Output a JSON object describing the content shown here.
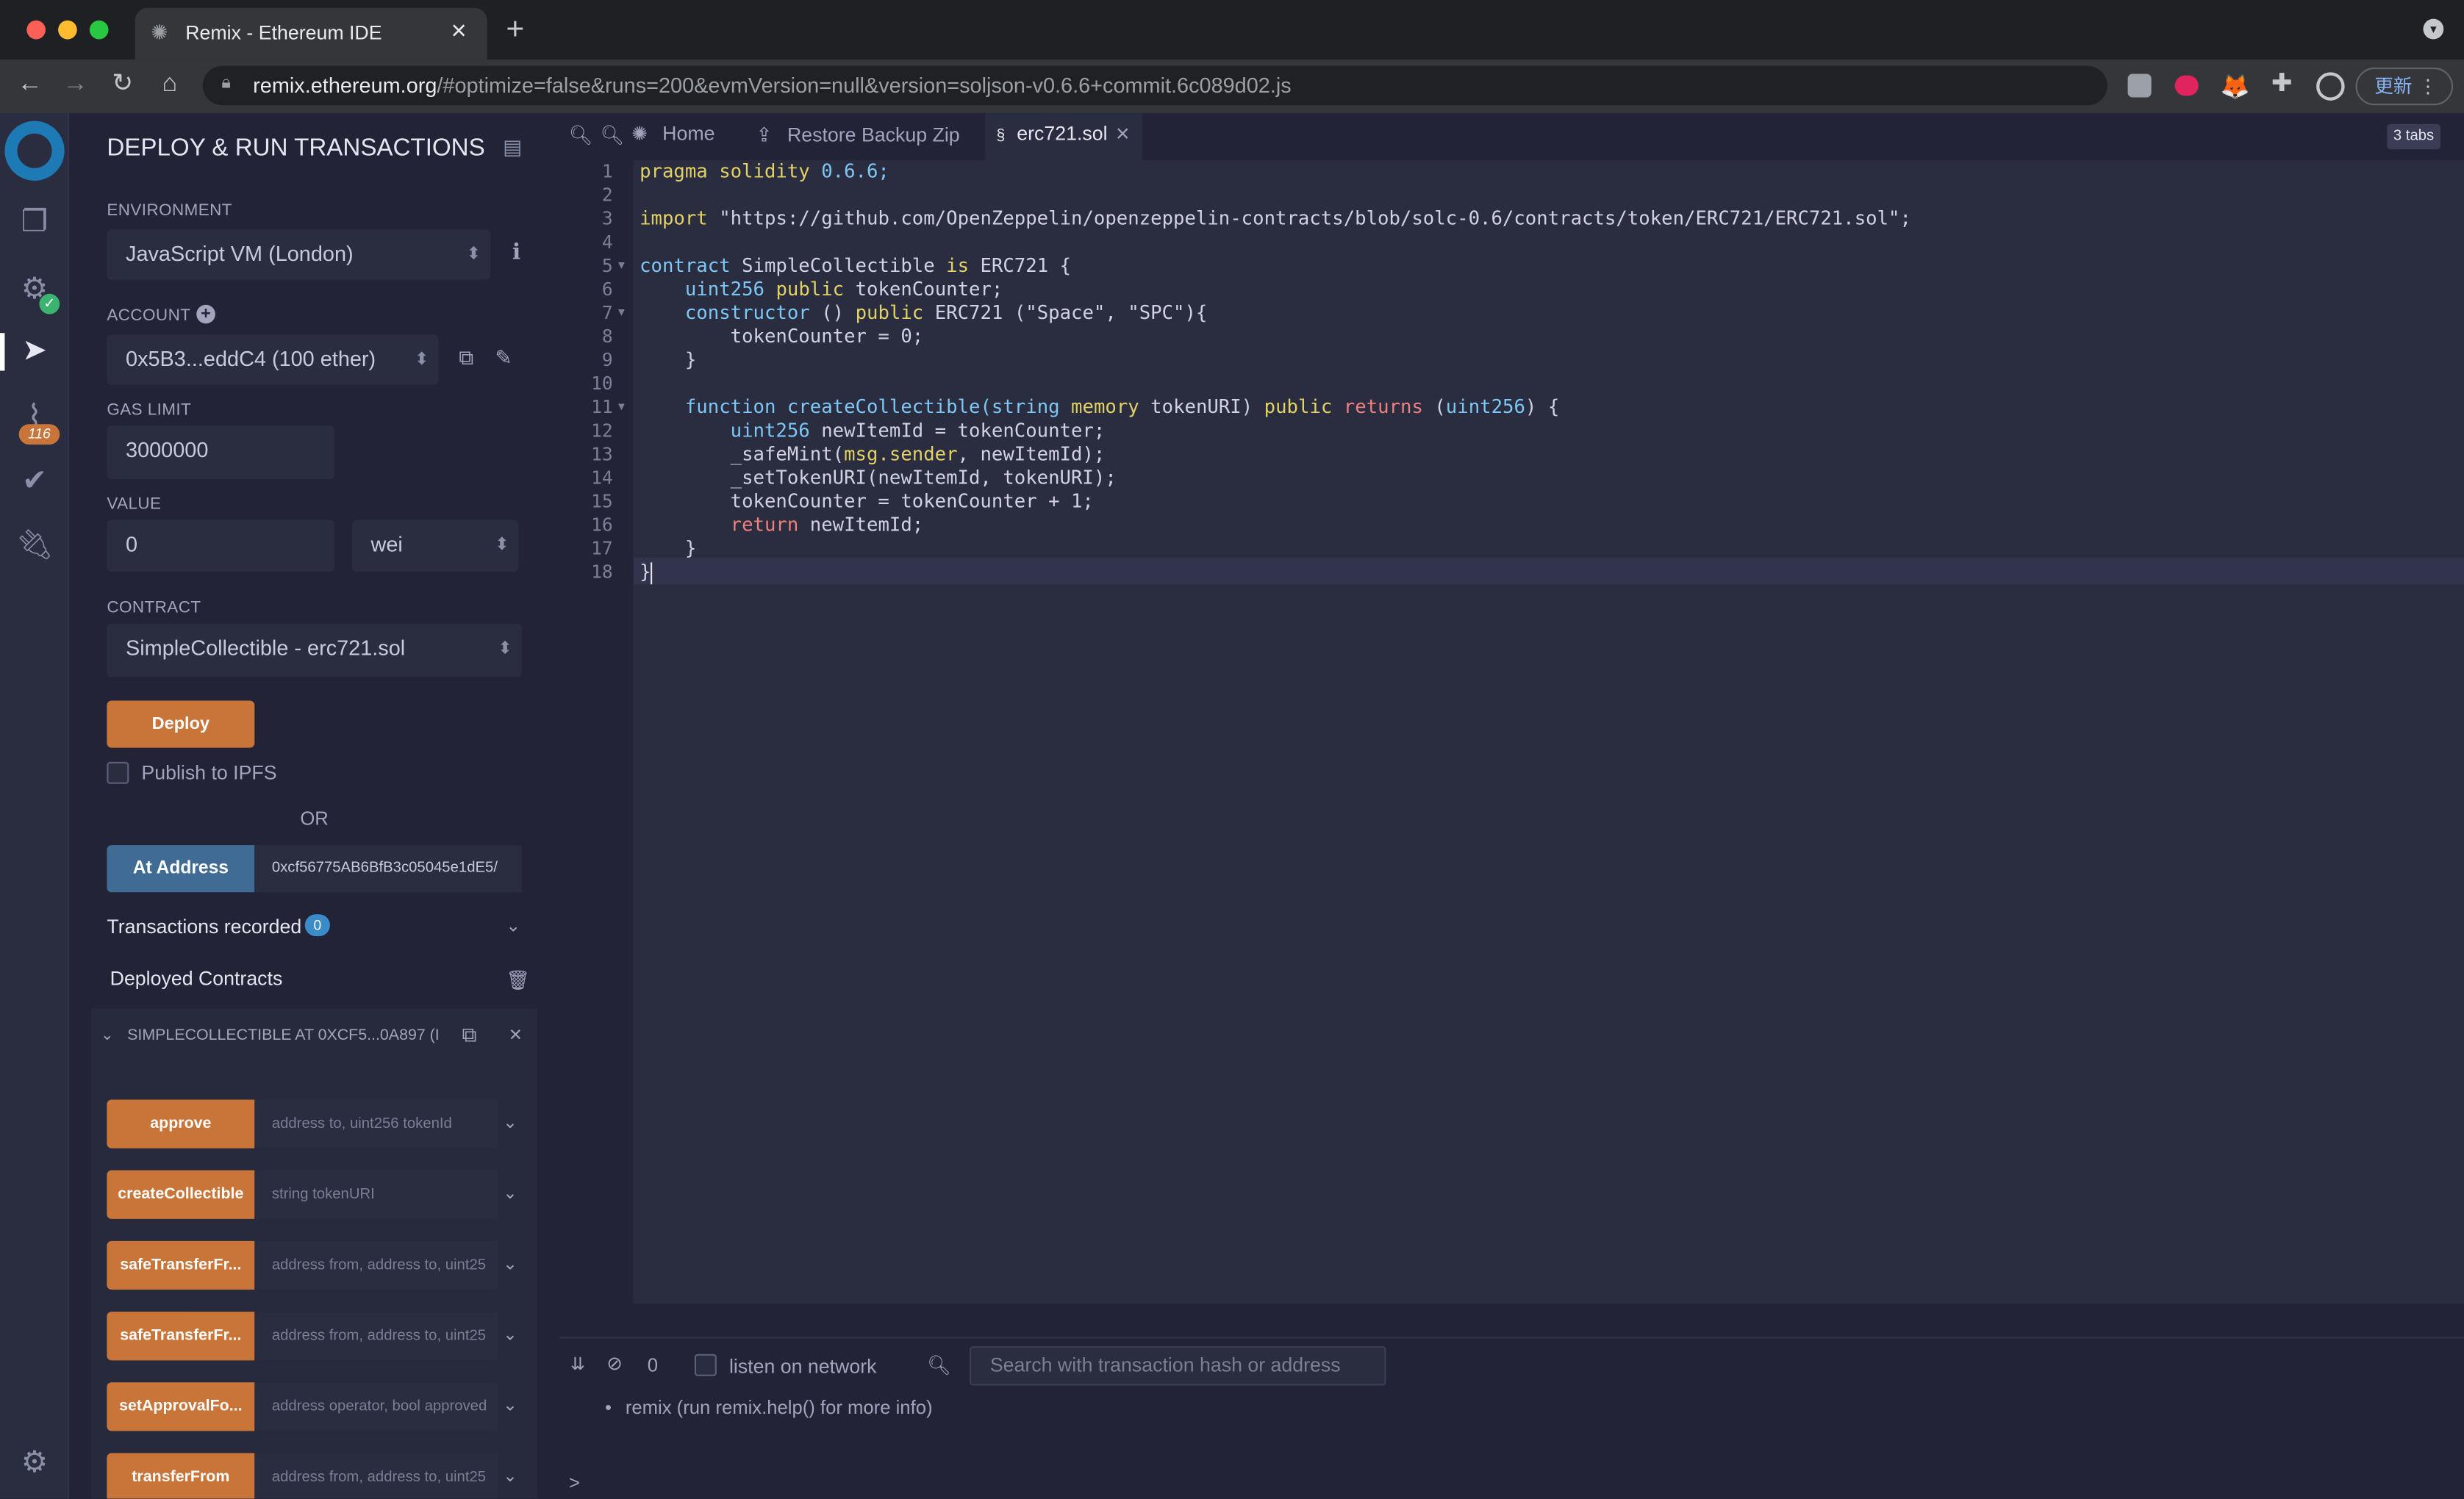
{
  "browser": {
    "tab_title": "Remix - Ethereum IDE",
    "url_host": "remix.ethereum.org",
    "url_rest": "/#optimize=false&runs=200&evmVersion=null&version=soljson-v0.6.6+commit.6c089d02.js",
    "update_label": "更新",
    "new_tab": "+",
    "close_tab": "×"
  },
  "plugin_badge": "116",
  "panel": {
    "title": "DEPLOY & RUN TRANSACTIONS",
    "environment_label": "ENVIRONMENT",
    "environment_value": "JavaScript VM (London)",
    "account_label": "ACCOUNT",
    "account_value": "0x5B3...eddC4 (100 ether)",
    "gas_limit_label": "GAS LIMIT",
    "gas_limit_value": "3000000",
    "value_label": "VALUE",
    "value_amount": "0",
    "value_unit": "wei",
    "contract_label": "CONTRACT",
    "contract_value": "SimpleCollectible - erc721.sol",
    "deploy_label": "Deploy",
    "publish_label": "Publish to IPFS",
    "or_label": "OR",
    "at_address_label": "At Address",
    "at_address_value": "0xcf56775AB6BfB3c05045e1dE5/",
    "tx_recorded_label": "Transactions recorded",
    "tx_recorded_count": "0",
    "deployed_label": "Deployed Contracts",
    "instance_label": "SIMPLECOLLECTIBLE AT 0XCF5...0A897 (I",
    "functions": [
      {
        "name": "approve",
        "placeholder": "address to, uint256 tokenId"
      },
      {
        "name": "createCollectible",
        "placeholder": "string tokenURI"
      },
      {
        "name": "safeTransferFr...",
        "placeholder": "address from, address to, uint25"
      },
      {
        "name": "safeTransferFr...",
        "placeholder": "address from, address to, uint25"
      },
      {
        "name": "setApprovalFo...",
        "placeholder": "address operator, bool approved"
      },
      {
        "name": "transferFrom",
        "placeholder": "address from, address to, uint25"
      }
    ]
  },
  "editor": {
    "tabs": [
      {
        "label": "Home"
      },
      {
        "label": "Restore Backup Zip"
      },
      {
        "label": "erc721.sol"
      }
    ],
    "tabs_count": "3 tabs",
    "line_numbers": [
      "1",
      "2",
      "3",
      "4",
      "5",
      "6",
      "7",
      "8",
      "9",
      "10",
      "11",
      "12",
      "13",
      "14",
      "15",
      "16",
      "17",
      "18"
    ],
    "code": {
      "l1a": "pragma solidity",
      "l1b": " 0.6.6;",
      "l3a": "import",
      "l3b": " \"https://github.com/OpenZeppelin/openzeppelin-contracts/blob/solc-0.6/contracts/token/ERC721/ERC721.sol\";",
      "l5a": "contract",
      "l5b": " SimpleCollectible ",
      "l5c": "is",
      "l5d": " ERC721 {",
      "l6a": "    uint256",
      "l6b": " public",
      "l6c": " tokenCounter;",
      "l7a": "    constructor",
      "l7b": " () ",
      "l7c": "public",
      "l7d": " ERC721 (\"Space\", \"SPC\"){",
      "l8": "        tokenCounter = 0;",
      "l9": "    }",
      "l11a": "    function",
      "l11b": " createCollectible(",
      "l11c": "string",
      "l11d": " memory",
      "l11e": " tokenURI) ",
      "l11f": "public",
      "l11g": " returns",
      "l11h": " (",
      "l11i": "uint256",
      "l11j": ") {",
      "l12a": "        uint256",
      "l12b": " newItemId = tokenCounter;",
      "l13a": "        _safeMint(",
      "l13b": "msg.sender",
      "l13c": ", newItemId);",
      "l14": "        _setTokenURI(newItemId, tokenURI);",
      "l15": "        tokenCounter = tokenCounter + 1;",
      "l16a": "        return",
      "l16b": " newItemId;",
      "l17": "    }",
      "l18": "}"
    }
  },
  "terminal": {
    "count": "0",
    "listen_label": "listen on network",
    "search_placeholder": "Search with transaction hash or address",
    "info_line": "remix (run remix.help() for more info)",
    "prompt": ">"
  },
  "colors": {
    "accent_orange": "#c97539",
    "at_address_blue": "#3f6b94",
    "editor_bg": "#2a2c3f",
    "panel_bg": "#222336"
  }
}
